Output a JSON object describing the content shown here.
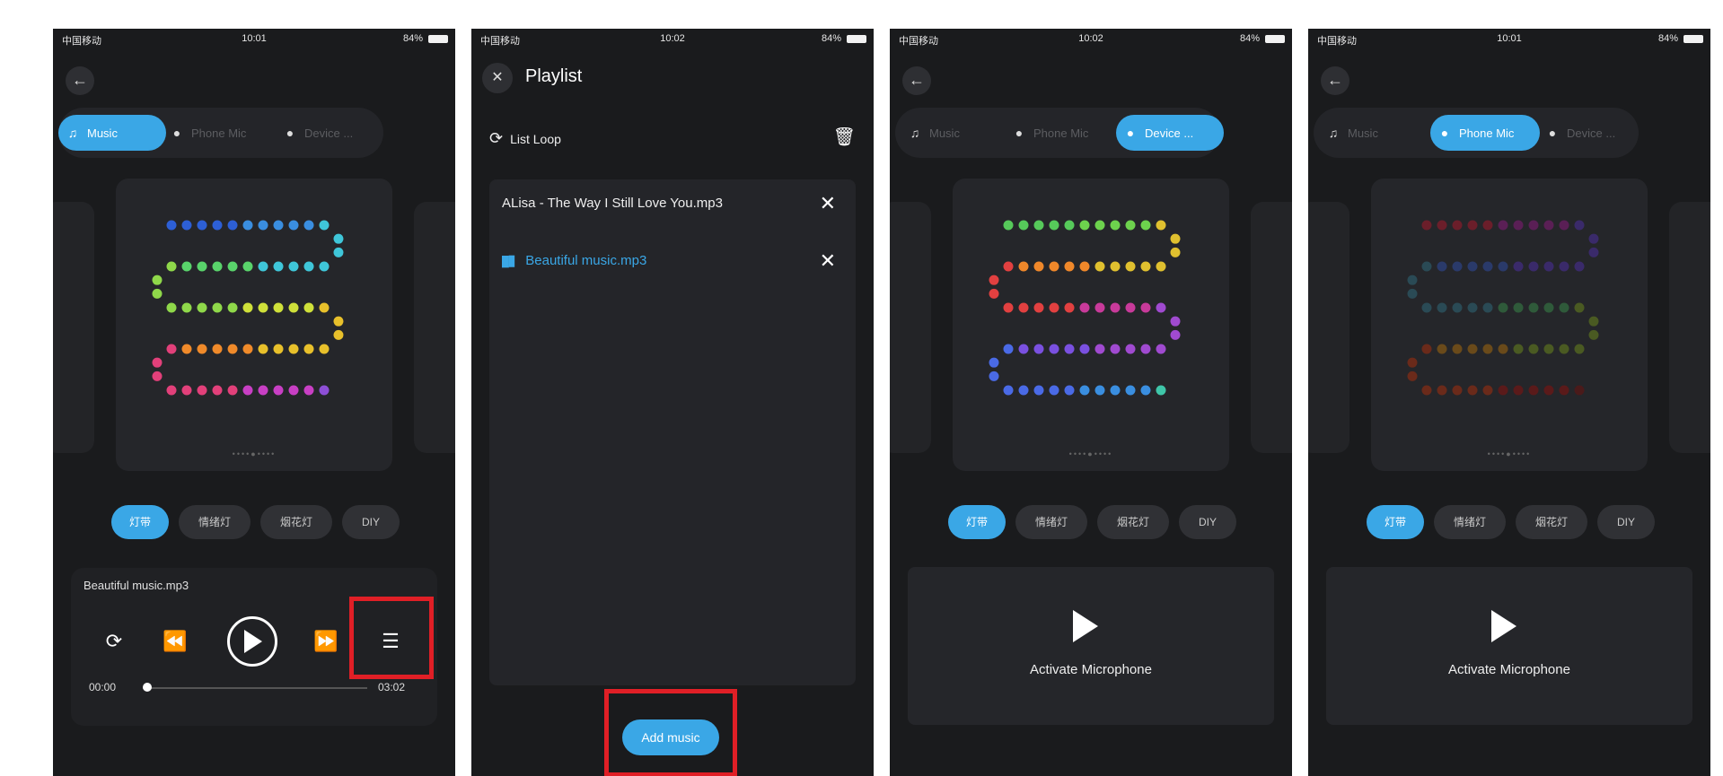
{
  "status": {
    "carrier": "中国移动",
    "battery": "84%",
    "times": [
      "10:01",
      "10:02",
      "10:02",
      "10:01"
    ]
  },
  "modes": [
    "Music",
    "Phone Mic",
    "Device ..."
  ],
  "effects": [
    "灯带",
    "情绪灯",
    "烟花灯",
    "DIY"
  ],
  "player": {
    "track": "Beautiful music.mp3",
    "elapsed": "00:00",
    "duration": "03:02",
    "progress": 0.0
  },
  "playlist": {
    "title": "Playlist",
    "loop_label": "List Loop",
    "items": [
      "ALisa - The Way I Still Love You.mp3",
      "Beautiful music.mp3"
    ],
    "add_label": "Add music"
  },
  "mic": {
    "label": "Activate Microphone"
  },
  "colors": {
    "accent": "#3aa7e6",
    "highlight": "#e01f26",
    "background": "#1a1b1d"
  }
}
